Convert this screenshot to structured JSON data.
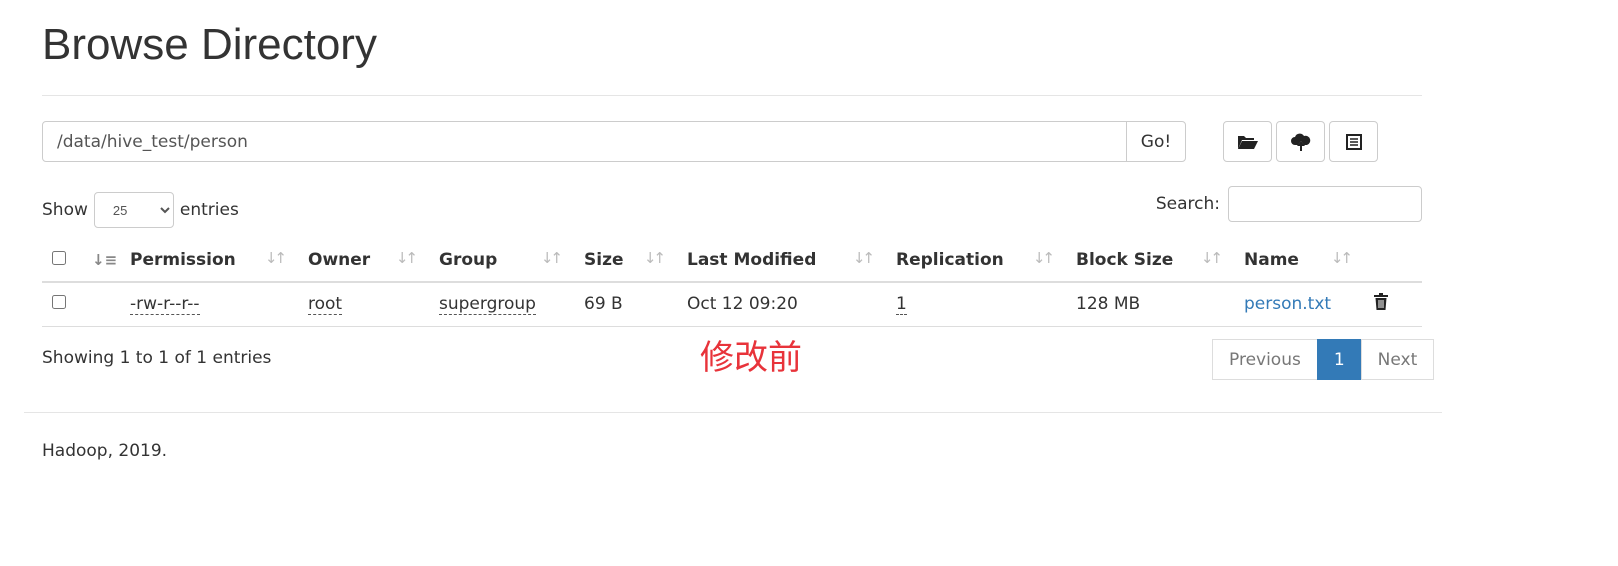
{
  "title": "Browse Directory",
  "path": "/data/hive_test/person",
  "go_label": "Go!",
  "toolbar": {
    "icons": [
      "folder-open-icon",
      "cloud-upload-icon",
      "list-alt-icon"
    ]
  },
  "length": {
    "show": "Show",
    "value": "25",
    "entries": "entries"
  },
  "search": {
    "label": "Search:",
    "value": ""
  },
  "columns": [
    "Permission",
    "Owner",
    "Group",
    "Size",
    "Last Modified",
    "Replication",
    "Block Size",
    "Name"
  ],
  "rows": [
    {
      "permission": "-rw-r--r--",
      "owner": "root",
      "group": "supergroup",
      "size": "69 B",
      "modified": "Oct 12 09:20",
      "replication": "1",
      "block_size": "128 MB",
      "name": "person.txt"
    }
  ],
  "info": "Showing 1 to 1 of 1 entries",
  "annotation": "修改前",
  "annotation_color": "#e8333a",
  "pagination": {
    "previous": "Previous",
    "current": "1",
    "next": "Next"
  },
  "footer": "Hadoop, 2019."
}
